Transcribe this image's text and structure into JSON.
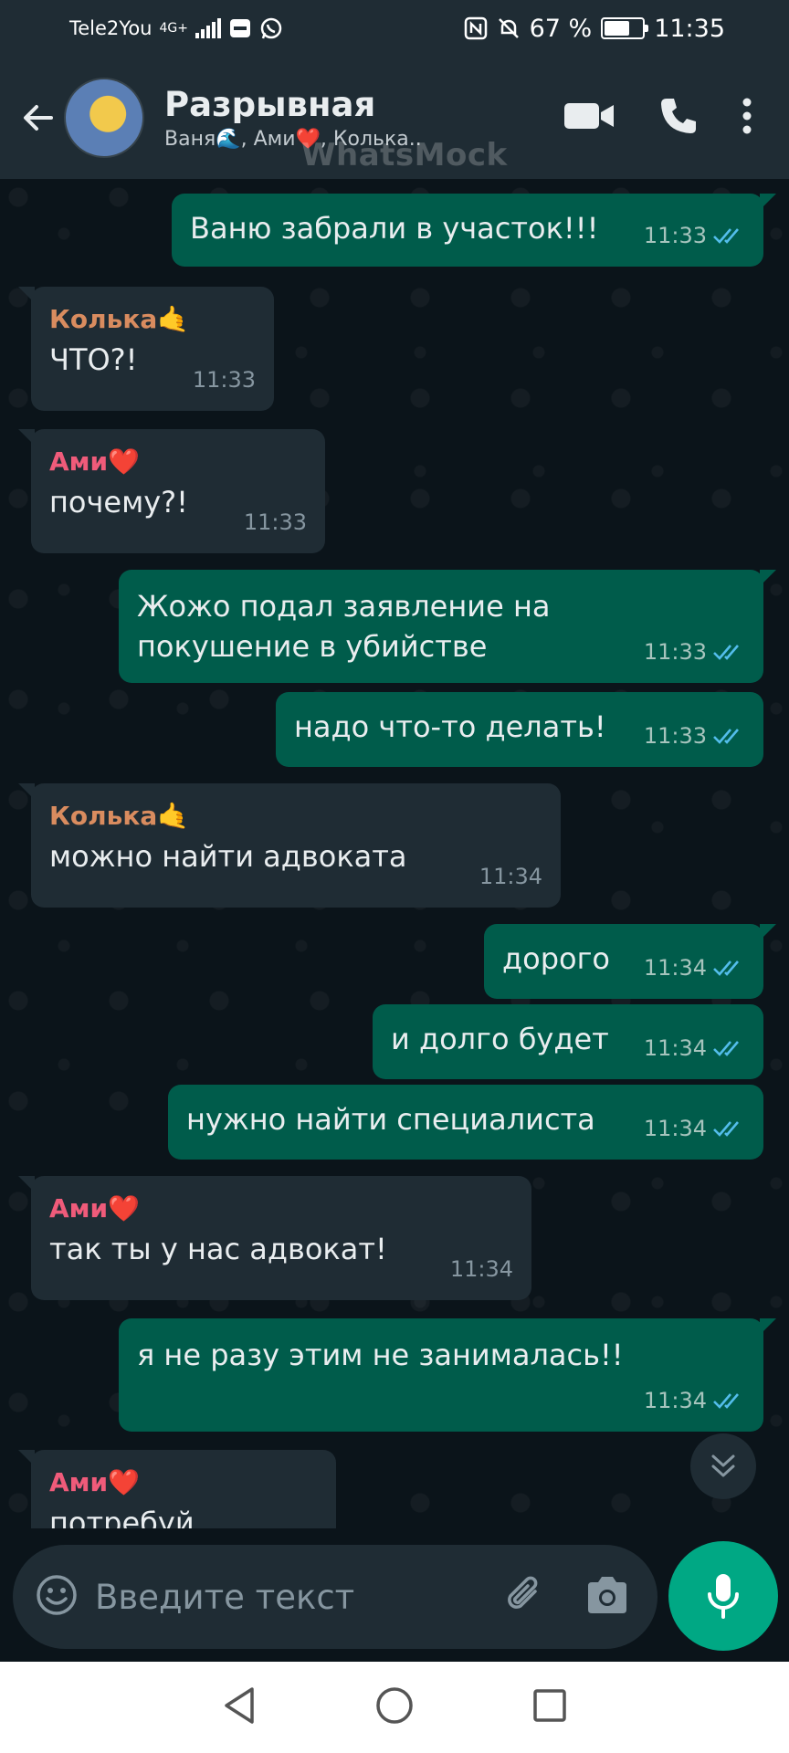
{
  "status_bar": {
    "carrier": "Tele2You",
    "network": "4G+",
    "battery_percent": "67 %",
    "battery_level": 0.67,
    "time": "11:35"
  },
  "header": {
    "title": "Разрывная",
    "subtitle": "Ваня🌊, Ами❤️, Колька..",
    "watermark": "WhatsMock"
  },
  "messages": [
    {
      "dir": "out",
      "text": "Ваню забрали в участок!!!",
      "time": "11:33"
    },
    {
      "dir": "in",
      "sender": "Колька🤙",
      "text": "ЧТО?!",
      "time": "11:33"
    },
    {
      "dir": "in",
      "sender": "Ами❤️",
      "text": "почему?!",
      "time": "11:33"
    },
    {
      "dir": "out",
      "text_line1": "Жожо подал заявление на",
      "text_line2": "покушение в убийстве",
      "time": "11:33"
    },
    {
      "dir": "out",
      "text": "надо что-то делать!",
      "time": "11:33"
    },
    {
      "dir": "in",
      "sender": "Колька🤙",
      "text": "можно найти адвоката",
      "time": "11:34"
    },
    {
      "dir": "out",
      "text": "дорого",
      "time": "11:34"
    },
    {
      "dir": "out",
      "text": "и долго будет",
      "time": "11:34"
    },
    {
      "dir": "out",
      "text": "нужно найти специалиста",
      "time": "11:34"
    },
    {
      "dir": "in",
      "sender": "Ами❤️",
      "text": "так ты у нас адвокат!",
      "time": "11:34"
    },
    {
      "dir": "out",
      "text": "я не разу этим не занималась!!",
      "time": "11:34"
    },
    {
      "dir": "in",
      "sender": "Ами❤️",
      "text": "потребуй"
    }
  ],
  "input": {
    "placeholder": "Введите текст"
  },
  "icons": {
    "back": "arrow-left-icon",
    "video": "video-camera-icon",
    "call": "phone-icon",
    "menu": "more-vert-icon",
    "emoji": "emoji-icon",
    "attach": "paperclip-icon",
    "camera": "camera-icon",
    "mic": "microphone-icon",
    "scroll": "chevron-double-down-icon"
  },
  "colors": {
    "accent": "#00a884",
    "outgoing_bubble": "#005c4b",
    "incoming_bubble": "#1f2c34",
    "read_ticks": "#53bdeb"
  }
}
